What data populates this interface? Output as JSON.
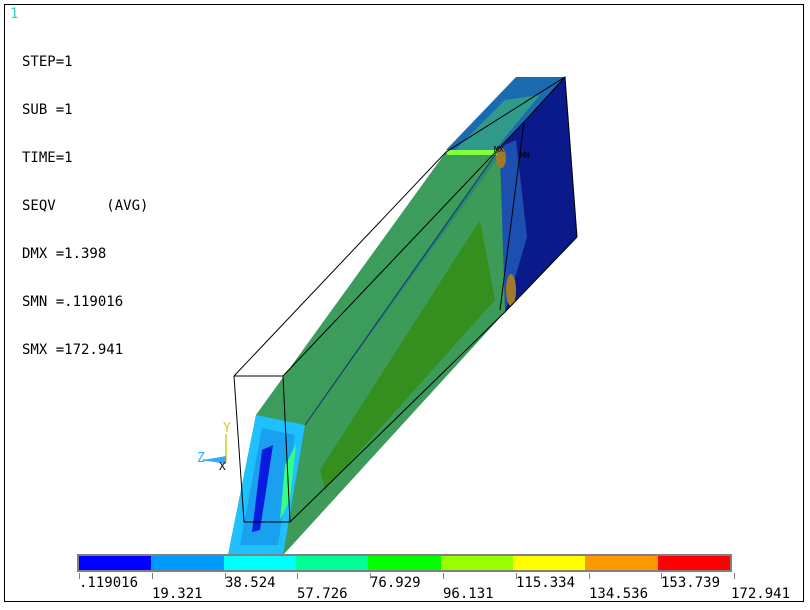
{
  "window_number": "1",
  "info": {
    "step": "STEP=1",
    "sub": "SUB =1",
    "time": "TIME=1",
    "seqv": "SEQV      (AVG)",
    "dmx": "DMX =1.398",
    "smn": "SMN =.119016",
    "smx": "SMX =172.941"
  },
  "triad": {
    "y_label": "Y",
    "z_label": "Z",
    "x_label": "X",
    "y_color": "#cccc33",
    "z_color": "#33aaff"
  },
  "markers": {
    "mx": "MX",
    "mn": "MN"
  },
  "legend": {
    "colors": [
      "#0000ff",
      "#0099ff",
      "#00ffff",
      "#00ff99",
      "#00ff00",
      "#99ff00",
      "#ffff00",
      "#ff9900",
      "#ff0000"
    ],
    "labels": [
      ".119016",
      "19.321",
      "38.524",
      "57.726",
      "76.929",
      "96.131",
      "115.334",
      "134.536",
      "153.739",
      "172.941"
    ]
  }
}
